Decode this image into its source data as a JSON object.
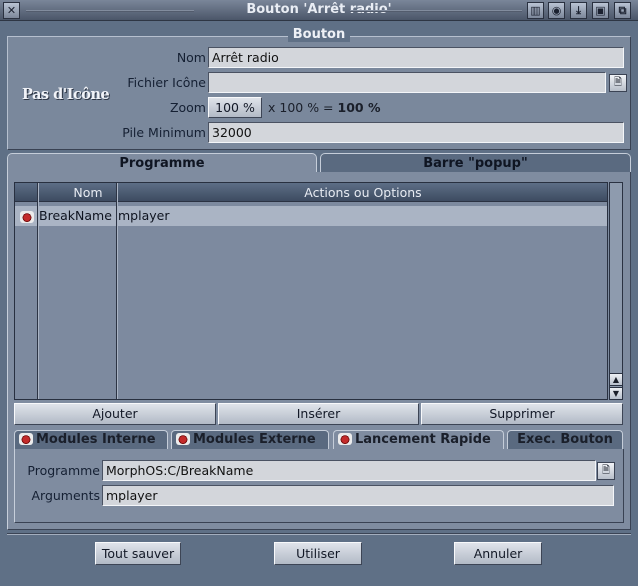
{
  "window": {
    "title": "Bouton 'Arrêt radio'"
  },
  "titlebar_icons": [
    "close-icon",
    "iconify-icon",
    "snapshot-icon",
    "depth-down-icon",
    "screen-icon",
    "zoom-icon"
  ],
  "bouton": {
    "group_title": "Bouton",
    "no_icon": "Pas d'Icône",
    "nom_label": "Nom",
    "nom_value": "Arrêt radio",
    "fichier_label": "Fichier Icône",
    "fichier_value": "",
    "zoom_label": "Zoom",
    "zoom_value": "100 %",
    "zoom_suffix": "x 100 % = ",
    "zoom_result": "100 %",
    "pile_label": "Pile Minimum",
    "pile_value": "32000"
  },
  "tabs": {
    "programme": "Programme",
    "barre": "Barre \"popup\""
  },
  "list": {
    "headers": {
      "nom": "Nom",
      "actions": "Actions ou Options"
    },
    "rows": [
      {
        "nom": "BreakName",
        "action": "mplayer"
      }
    ]
  },
  "actions": {
    "ajouter": "Ajouter",
    "inserer": "Insérer",
    "supprimer": "Supprimer"
  },
  "modules": {
    "interne": "Modules Interne",
    "externe": "Modules Externe",
    "lancement": "Lancement Rapide",
    "exec": "Exec. Bouton"
  },
  "launch": {
    "programme_label": "Programme",
    "programme_value": "MorphOS:C/BreakName",
    "arguments_label": "Arguments",
    "arguments_value": "mplayer"
  },
  "footer": {
    "save_all": "Tout sauver",
    "use": "Utiliser",
    "cancel": "Annuler"
  }
}
